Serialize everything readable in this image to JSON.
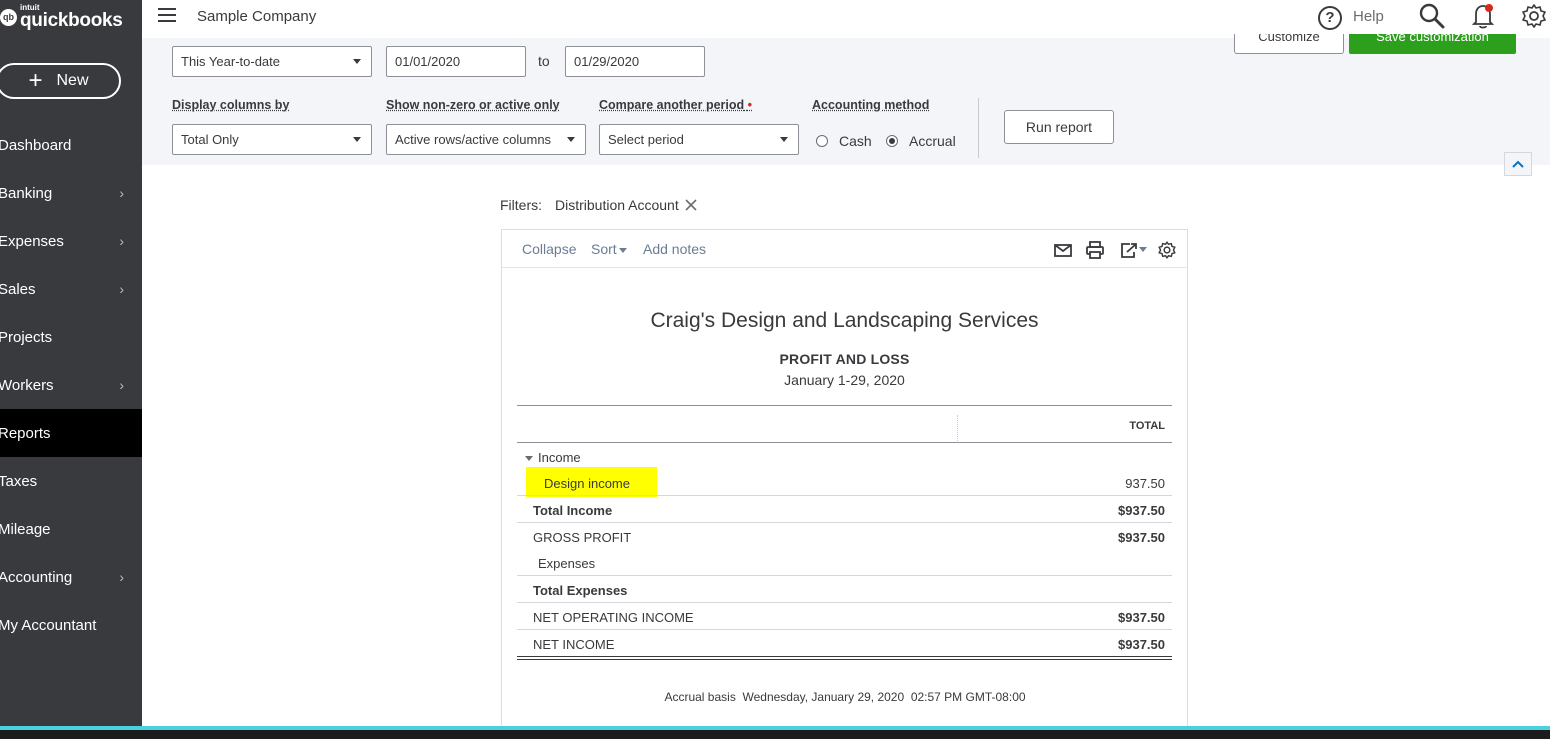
{
  "brand": {
    "intuit": "intuit",
    "name": "quickbooks"
  },
  "sidebar": {
    "new_label": "New",
    "items": [
      {
        "label": "Dashboard",
        "chevron": false,
        "active": false
      },
      {
        "label": "Banking",
        "chevron": true,
        "active": false
      },
      {
        "label": "Expenses",
        "chevron": true,
        "active": false
      },
      {
        "label": "Sales",
        "chevron": true,
        "active": false
      },
      {
        "label": "Projects",
        "chevron": false,
        "active": false
      },
      {
        "label": "Workers",
        "chevron": true,
        "active": false
      },
      {
        "label": "Reports",
        "chevron": false,
        "active": true
      },
      {
        "label": "Taxes",
        "chevron": false,
        "active": false
      },
      {
        "label": "Mileage",
        "chevron": false,
        "active": false
      },
      {
        "label": "Accounting",
        "chevron": true,
        "active": false
      },
      {
        "label": "My Accountant",
        "chevron": false,
        "active": false
      }
    ]
  },
  "header": {
    "company": "Sample Company",
    "help_label": "Help",
    "help_glyph": "?"
  },
  "filters_panel": {
    "customize_label": "Customize",
    "save_customization_label": "Save customization",
    "date_range": "This Year-to-date",
    "date_from": "01/01/2020",
    "to_label": "to",
    "date_to": "01/29/2020",
    "display_columns_label": "Display columns by",
    "display_columns_value": "Total Only",
    "show_nonzero_label": "Show non-zero or active only",
    "show_nonzero_value": "Active rows/active columns",
    "compare_label": "Compare another period",
    "compare_required": "•",
    "compare_value": "Select period",
    "accounting_method_label": "Accounting method",
    "method_options": [
      "Cash",
      "Accrual"
    ],
    "method_selected": "Accrual",
    "run_report_label": "Run report"
  },
  "report": {
    "filters_label": "Filters:",
    "filter_value": "Distribution Account",
    "toolbar": {
      "collapse": "Collapse",
      "sort": "Sort",
      "add_notes": "Add notes"
    },
    "company_name": "Craig's Design and Landscaping Services",
    "title": "PROFIT AND LOSS",
    "period": "January 1-29, 2020",
    "column_header": "TOTAL",
    "rows": {
      "income": "Income",
      "design_income": {
        "name": "Design income",
        "amount": "937.50"
      },
      "total_income": {
        "name": "Total Income",
        "amount": "$937.50"
      },
      "gross_profit": {
        "name": "GROSS PROFIT",
        "amount": "$937.50"
      },
      "expenses": "Expenses",
      "total_expenses": {
        "name": "Total Expenses",
        "amount": ""
      },
      "net_operating_income": {
        "name": "NET OPERATING INCOME",
        "amount": "$937.50"
      },
      "net_income": {
        "name": "NET INCOME",
        "amount": "$937.50"
      }
    },
    "footer": "Accrual basis  Wednesday, January 29, 2020  02:57 PM GMT-08:00",
    "highlight_color": "#ffff00"
  },
  "colors": {
    "sidebar": "#393a3d",
    "active_nav": "#000000",
    "accent_green": "#2ca01c",
    "link": "#6b7c93"
  }
}
